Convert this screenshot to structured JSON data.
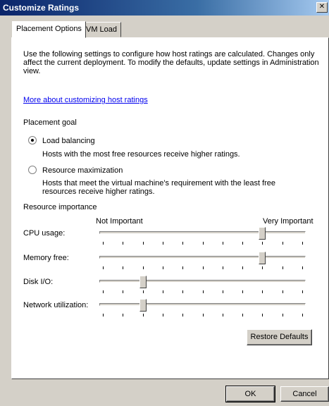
{
  "window": {
    "title": "Customize Ratings",
    "close_glyph": "✕"
  },
  "tabs": [
    {
      "label": "Placement Options"
    },
    {
      "label": "VM Load"
    }
  ],
  "intro_text": "Use the following settings to configure how host ratings are calculated. Changes only affect the current deployment. To modify the defaults, update settings in Administration view.",
  "help_link": "More about customizing host ratings",
  "placement_goal": {
    "label": "Placement goal",
    "options": [
      {
        "label": "Load balancing",
        "description": "Hosts with the most free resources receive higher ratings.",
        "selected": true
      },
      {
        "label": "Resource maximization",
        "description": "Hosts that meet the virtual machine's requirement with the least free resources receive higher ratings.",
        "selected": false
      }
    ]
  },
  "resource_importance": {
    "label": "Resource importance",
    "scale_min_label": "Not Important",
    "scale_max_label": "Very Important",
    "tick_count": 11,
    "sliders": [
      {
        "label": "CPU usage:",
        "level": 8
      },
      {
        "label": "Memory free:",
        "level": 8
      },
      {
        "label": "Disk I/O:",
        "level": 2
      },
      {
        "label": "Network utilization:",
        "level": 2
      }
    ]
  },
  "buttons": {
    "restore_defaults": "Restore Defaults",
    "ok": "OK",
    "cancel": "Cancel"
  }
}
